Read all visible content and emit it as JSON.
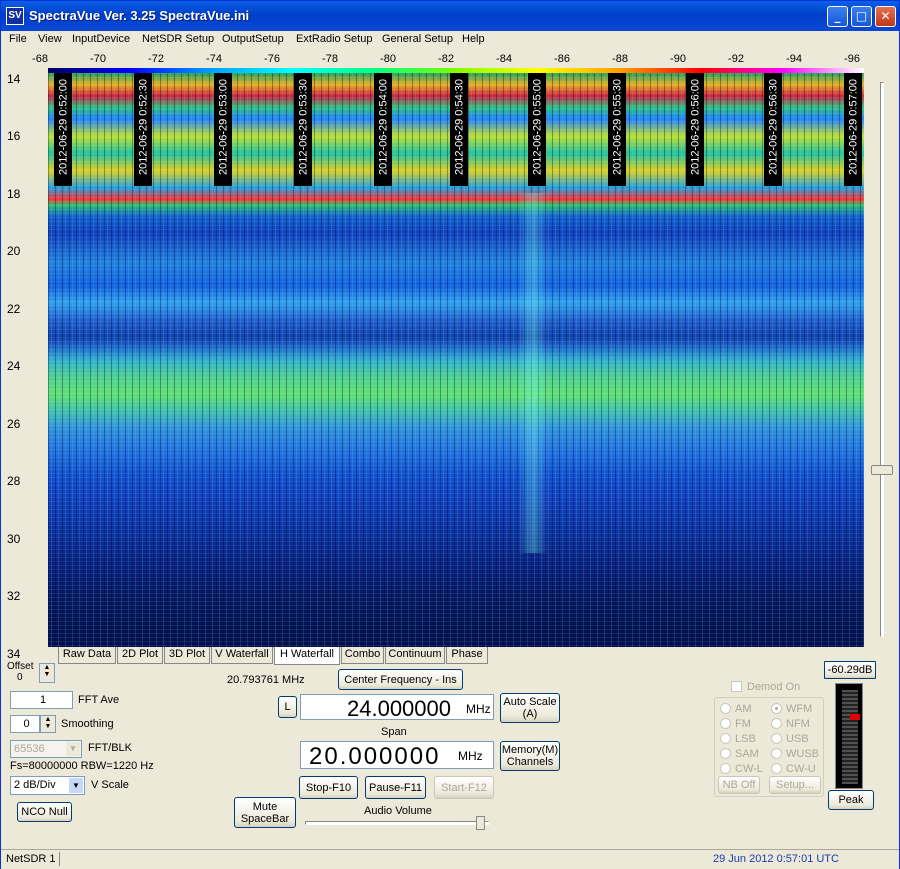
{
  "window": {
    "title": "SpectraVue Ver. 3.25  SpectraVue.ini",
    "icon_text": "SV",
    "minimize": "_",
    "maximize": "□",
    "close": "✕"
  },
  "menu": [
    "File",
    "View",
    "InputDevice",
    "NetSDR Setup",
    "OutputSetup",
    "ExtRadio Setup",
    "General Setup",
    "Help"
  ],
  "top_axis_ticks": [
    "-68",
    "-70",
    "-72",
    "-74",
    "-76",
    "-78",
    "-80",
    "-82",
    "-84",
    "-86",
    "-88",
    "-90",
    "-92",
    "-94",
    "-96"
  ],
  "left_axis_ticks": [
    "14",
    "16",
    "18",
    "20",
    "22",
    "24",
    "26",
    "28",
    "30",
    "32",
    "34"
  ],
  "timestamps": [
    "2012-06-29 0:52:00",
    "2012-06-29 0:52:30",
    "2012-06-29 0:53:00",
    "2012-06-29 0:53:30",
    "2012-06-29 0:54:00",
    "2012-06-29 0:54:30",
    "2012-06-29 0:55:00",
    "2012-06-29 0:55:30",
    "2012-06-29 0:56:00",
    "2012-06-29 0:56:30",
    "2012-06-29 0:57:00"
  ],
  "tabs": [
    "Raw Data",
    "2D Plot",
    "3D Plot",
    "V Waterfall",
    "H Waterfall",
    "Combo",
    "Continuum",
    "Phase"
  ],
  "active_tab": "H Waterfall",
  "offset": {
    "label": "Offset",
    "value": "0"
  },
  "fft_ave": {
    "value": "1",
    "label": "FFT Ave"
  },
  "smoothing": {
    "value": "0",
    "label": "Smoothing"
  },
  "fft_blk": {
    "value": "65536",
    "label": "FFT/BLK"
  },
  "fs_info": "Fs=80000000 RBW=1220 Hz",
  "vscale": {
    "value": "2 dB/Div",
    "label": "V Scale"
  },
  "nco_null": "NCO Null",
  "cursor_freq": "20.793761 MHz",
  "center_freq_button": "Center Frequency - Ins",
  "l_button": "L",
  "center_freq": {
    "value": "24.000000",
    "unit": "MHz"
  },
  "auto_scale": "Auto Scale\n(A)",
  "span": {
    "label": "Span",
    "value": "20.000000",
    "unit": "MHz"
  },
  "memory_button": "Memory(M)\nChannels",
  "stop_button": "Stop-F10",
  "pause_button": "Pause-F11",
  "start_button": "Start-F12",
  "mute_button": "Mute\nSpaceBar",
  "audio_volume": {
    "label": "Audio Volume",
    "level": 0.93
  },
  "demod": {
    "label": "Demod On",
    "modes": [
      "AM",
      "WFM",
      "FM",
      "NFM",
      "LSB",
      "USB",
      "SAM",
      "WUSB",
      "CW-L",
      "CW-U"
    ],
    "selected": "WFM",
    "nb_off": "NB Off",
    "setup": "Setup..."
  },
  "peak_readout": "-60.29dB",
  "peak_button": "Peak",
  "status": {
    "left": "NetSDR 1",
    "right": "29 Jun 2012  0:57:01 UTC"
  },
  "colors": {
    "title_bar": "#0a5fe8",
    "status_date": "#1a3cb0",
    "meter_marker": "#e00000"
  }
}
